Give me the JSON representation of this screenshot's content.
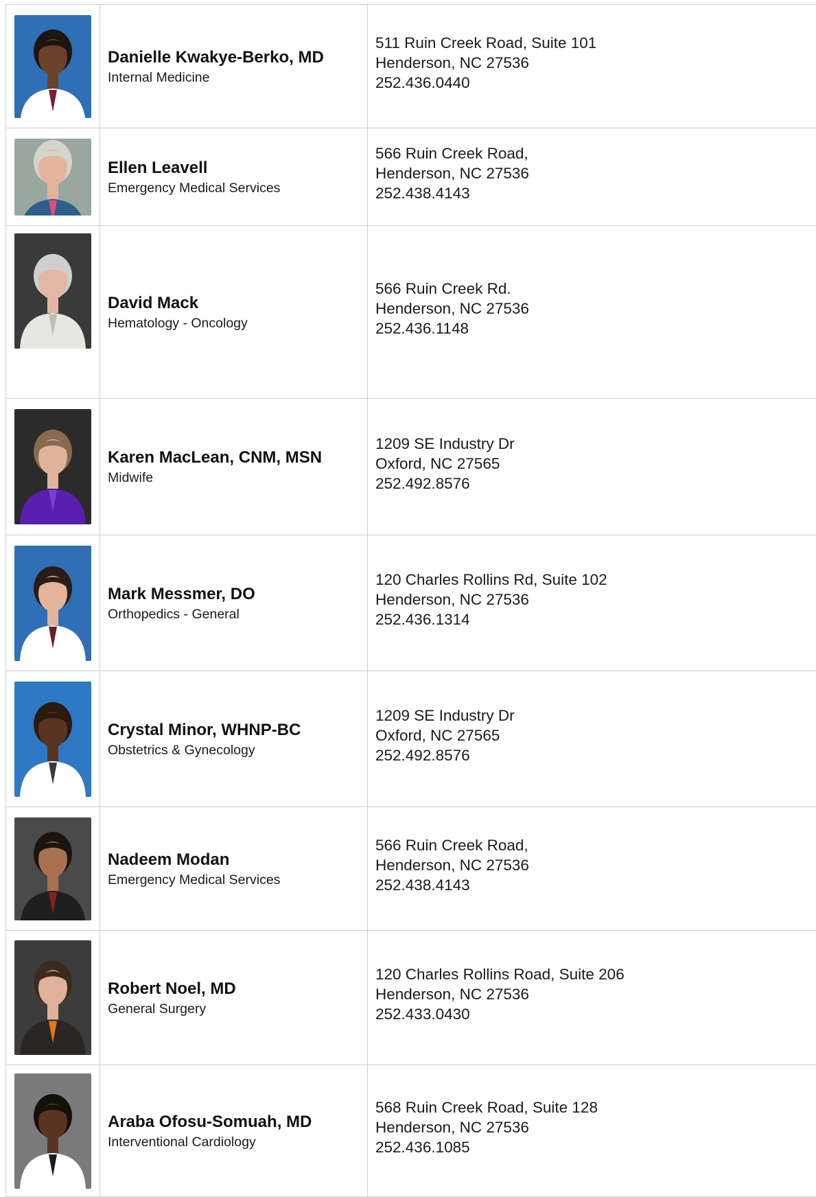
{
  "providers": [
    {
      "name": "Danielle Kwakye-Berko, MD",
      "specialty": "Internal Medicine",
      "address_line1": "511 Ruin Creek Road, Suite 101",
      "address_line2": "Henderson, NC 27536",
      "phone": "252.436.0440",
      "photo": {
        "bg": "#2f6fb5",
        "skin": "#6b4128",
        "hair": "#1e1410",
        "clothing": "#ffffff",
        "accent": "#7a1f2e"
      }
    },
    {
      "name": "Ellen Leavell",
      "specialty": "Emergency Medical Services",
      "address_line1": "566 Ruin Creek Road,",
      "address_line2": "Henderson, NC 27536",
      "phone": "252.438.4143",
      "photo": {
        "bg": "#9aa6a0",
        "skin": "#e3b49a",
        "hair": "#d6d3cc",
        "clothing": "#2d5f8a",
        "accent": "#d94f7a"
      }
    },
    {
      "name": "David Mack",
      "specialty": "Hematology - Oncology",
      "address_line1": "566 Ruin Creek Rd.",
      "address_line2": "Henderson, NC 27536",
      "phone": "252.436.1148",
      "photo": {
        "bg": "#3a3a3a",
        "skin": "#e2b8a4",
        "hair": "#cfcfcf",
        "clothing": "#e6e8df",
        "accent": "#bdbdb5"
      }
    },
    {
      "name": "Karen MacLean, CNM, MSN",
      "specialty": "Midwife",
      "address_line1": "1209 SE Industry Dr",
      "address_line2": "Oxford, NC 27565",
      "phone": "252.492.8576",
      "photo": {
        "bg": "#2b2b2b",
        "skin": "#e0b39b",
        "hair": "#8a6a4c",
        "clothing": "#5a1fb0",
        "accent": "#7a3fd0"
      }
    },
    {
      "name": "Mark Messmer, DO",
      "specialty": "Orthopedics - General",
      "address_line1": "120 Charles Rollins Rd, Suite 102",
      "address_line2": "Henderson, NC 27536",
      "phone": "252.436.1314",
      "photo": {
        "bg": "#2f6fb5",
        "skin": "#e3b49a",
        "hair": "#2a1d15",
        "clothing": "#ffffff",
        "accent": "#6b1f2e"
      }
    },
    {
      "name": "Crystal Minor, WHNP-BC",
      "specialty": "Obstetrics & Gynecology",
      "address_line1": "1209 SE Industry Dr",
      "address_line2": "Oxford, NC 27565",
      "phone": "252.492.8576",
      "photo": {
        "bg": "#2f78c4",
        "skin": "#5a3420",
        "hair": "#2a1a10",
        "clothing": "#ffffff",
        "accent": "#3a3a3a"
      }
    },
    {
      "name": "Nadeem Modan",
      "specialty": "Emergency Medical Services",
      "address_line1": "566 Ruin Creek Road,",
      "address_line2": "Henderson, NC 27536",
      "phone": "252.438.4143",
      "photo": {
        "bg": "#4a4a4a",
        "skin": "#a8714f",
        "hair": "#1b1410",
        "clothing": "#1f1f1f",
        "accent": "#8a1e24"
      }
    },
    {
      "name": "Robert Noel, MD",
      "specialty": "General Surgery",
      "address_line1": "120 Charles Rollins Road, Suite 206",
      "address_line2": "Henderson, NC 27536",
      "phone": "252.433.0430",
      "photo": {
        "bg": "#3c3c3c",
        "skin": "#e0b29a",
        "hair": "#3b2a20",
        "clothing": "#2a2623",
        "accent": "#e0781e"
      }
    },
    {
      "name": "Araba Ofosu-Somuah, MD",
      "specialty": "Interventional Cardiology",
      "address_line1": "568 Ruin Creek Road, Suite 128",
      "address_line2": "Henderson, NC 27536",
      "phone": "252.436.1085",
      "photo": {
        "bg": "#7a7a7a",
        "skin": "#5a3420",
        "hair": "#14100c",
        "clothing": "#ffffff",
        "accent": "#1c1c1c"
      }
    }
  ]
}
